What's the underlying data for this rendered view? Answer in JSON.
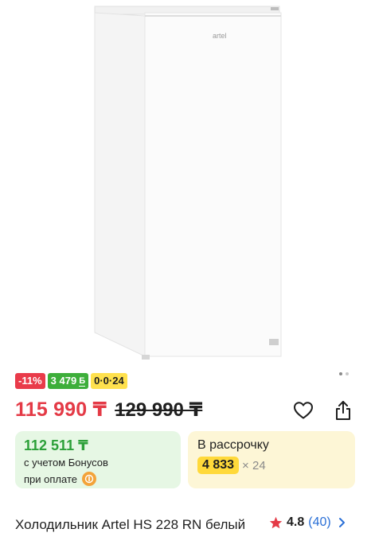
{
  "product": {
    "image_alt": "Холодильник Artel HS 228 RN белый",
    "brand_mark": "artel",
    "title": "Холодильник Artel HS 228 RN белый"
  },
  "badges": {
    "discount": "-11%",
    "bonus": "3 479",
    "bonus_glyph": "Б",
    "installment": "0·0·24"
  },
  "price": {
    "current": "115 990 ₸",
    "old": "129 990 ₸"
  },
  "bonus_card": {
    "price": "112 511 ₸",
    "note1": "с учетом Бонусов",
    "note2": "при оплате"
  },
  "credit_card": {
    "title": "В рассрочку",
    "monthly": "4 833",
    "months": "× 24"
  },
  "rating": {
    "value": "4.8",
    "count": "(40)"
  },
  "colors": {
    "discount": "#e93b4a",
    "bonus": "#3dae3a",
    "installment": "#ffe14d",
    "price": "#e43a46",
    "link": "#2a6fd6"
  },
  "icons": [
    "heart-icon",
    "share-icon",
    "star-icon",
    "chevron-right-icon",
    "kaspi-icon"
  ]
}
